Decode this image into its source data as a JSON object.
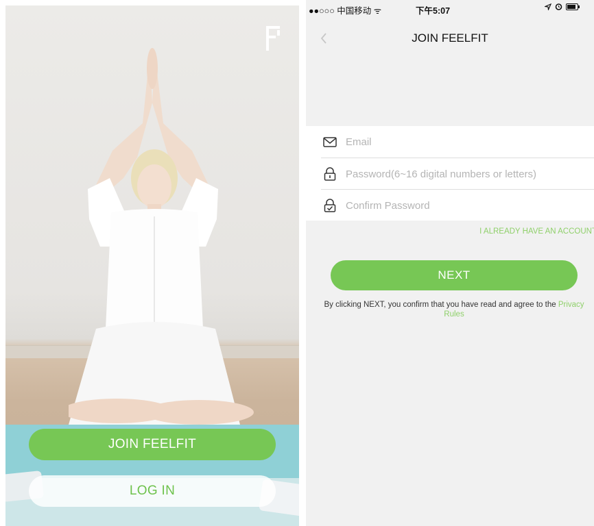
{
  "colors": {
    "accent_green": "#77c755",
    "link_green": "#8fd06a",
    "background_gray": "#f1f1f1"
  },
  "welcome": {
    "logo_icon": "feelfit-f-logo",
    "join_button": "JOIN FEELFIT",
    "login_button": "LOG IN"
  },
  "statusbar": {
    "carrier": "●●○○○ 中国移动 ᯤ",
    "time": "下午5:07",
    "icons": [
      "location-arrow-icon",
      "alarm-icon",
      "battery-icon"
    ]
  },
  "signup": {
    "back_icon": "chevron-left-icon",
    "title": "JOIN FEELFIT",
    "fields": {
      "email": {
        "icon": "mail-icon",
        "placeholder": "Email",
        "value": ""
      },
      "password": {
        "icon": "lock-icon",
        "placeholder": "Password(6~16 digital numbers or letters)",
        "value": ""
      },
      "confirm": {
        "icon": "lock-check-icon",
        "placeholder": "Confirm Password",
        "value": ""
      }
    },
    "already_link": "I ALREADY HAVE AN ACCOUNT",
    "next_button": "NEXT",
    "terms_text": "By clicking NEXT, you confirm that you have read and agree to the",
    "privacy_link": "Privacy Rules"
  }
}
